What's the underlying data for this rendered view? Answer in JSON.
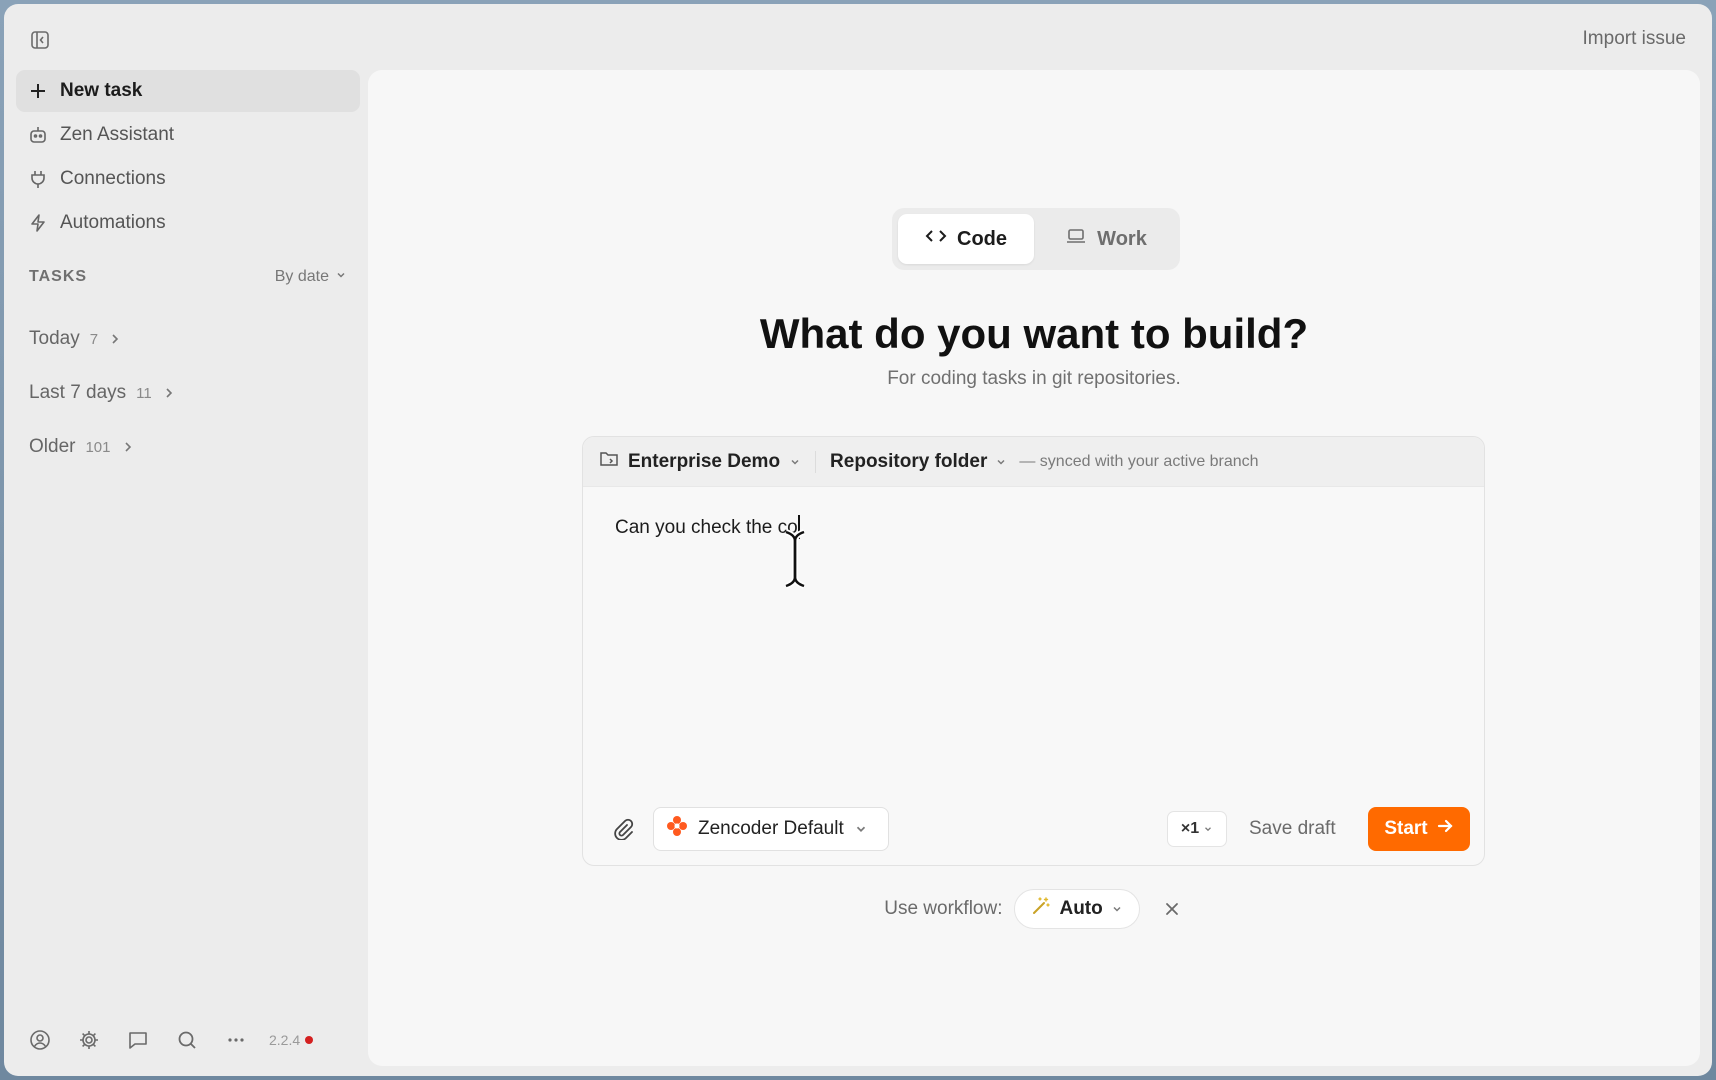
{
  "sidebar": {
    "nav": [
      {
        "label": "New task",
        "icon": "plus-icon"
      },
      {
        "label": "Zen Assistant",
        "icon": "robot-icon"
      },
      {
        "label": "Connections",
        "icon": "plug-icon"
      },
      {
        "label": "Automations",
        "icon": "lightning-icon"
      }
    ],
    "tasks_title": "TASKS",
    "sort_label": "By date",
    "groups": [
      {
        "label": "Today",
        "count": "7"
      },
      {
        "label": "Last 7 days",
        "count": "11"
      },
      {
        "label": "Older",
        "count": "101"
      }
    ],
    "version": "2.2.4"
  },
  "header": {
    "import_label": "Import issue"
  },
  "main": {
    "modes": [
      {
        "label": "Code",
        "icon": "code-icon",
        "active": true
      },
      {
        "label": "Work",
        "icon": "laptop-icon",
        "active": false
      }
    ],
    "heading": "What do you want to build?",
    "subheading": "For coding tasks in git repositories.",
    "composer": {
      "project": "Enterprise Demo",
      "repo": "Repository folder",
      "synced_note": "— synced with your active branch",
      "prompt_value": "Can you check the co",
      "agent": "Zencoder Default",
      "multiplier": "×1",
      "save_draft": "Save draft",
      "start": "Start"
    },
    "workflow": {
      "label": "Use workflow:",
      "value": "Auto"
    }
  },
  "colors": {
    "accent": "#ff6a00",
    "version_dot": "#d42020"
  }
}
